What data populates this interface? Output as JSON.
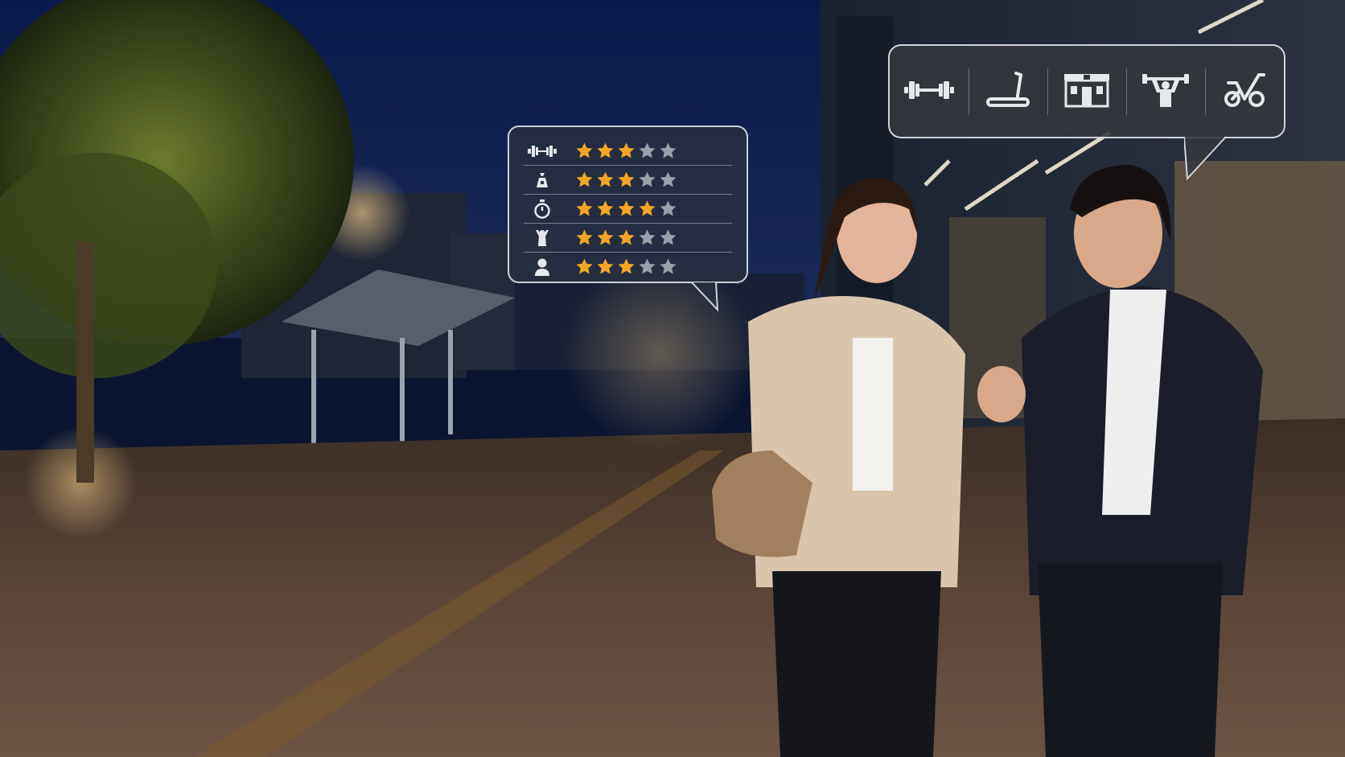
{
  "colors": {
    "star_filled": "#f3a623",
    "star_empty": "#9aa0aa",
    "bubble_border": "#e9edf4",
    "icon": "#e6e8ec"
  },
  "rating_card": {
    "rows": [
      {
        "icon": "dumbbell-icon",
        "rating": 3,
        "max": 5
      },
      {
        "icon": "weight-bag-icon",
        "rating": 3,
        "max": 5
      },
      {
        "icon": "stopwatch-icon",
        "rating": 4,
        "max": 5
      },
      {
        "icon": "trainer-icon",
        "rating": 3,
        "max": 5
      },
      {
        "icon": "person-icon",
        "rating": 3,
        "max": 5
      }
    ]
  },
  "category_bar": {
    "items": [
      {
        "icon": "dumbbell-icon"
      },
      {
        "icon": "treadmill-icon"
      },
      {
        "icon": "gym-building-icon"
      },
      {
        "icon": "weightlifter-icon"
      },
      {
        "icon": "exercise-bike-icon"
      }
    ]
  }
}
